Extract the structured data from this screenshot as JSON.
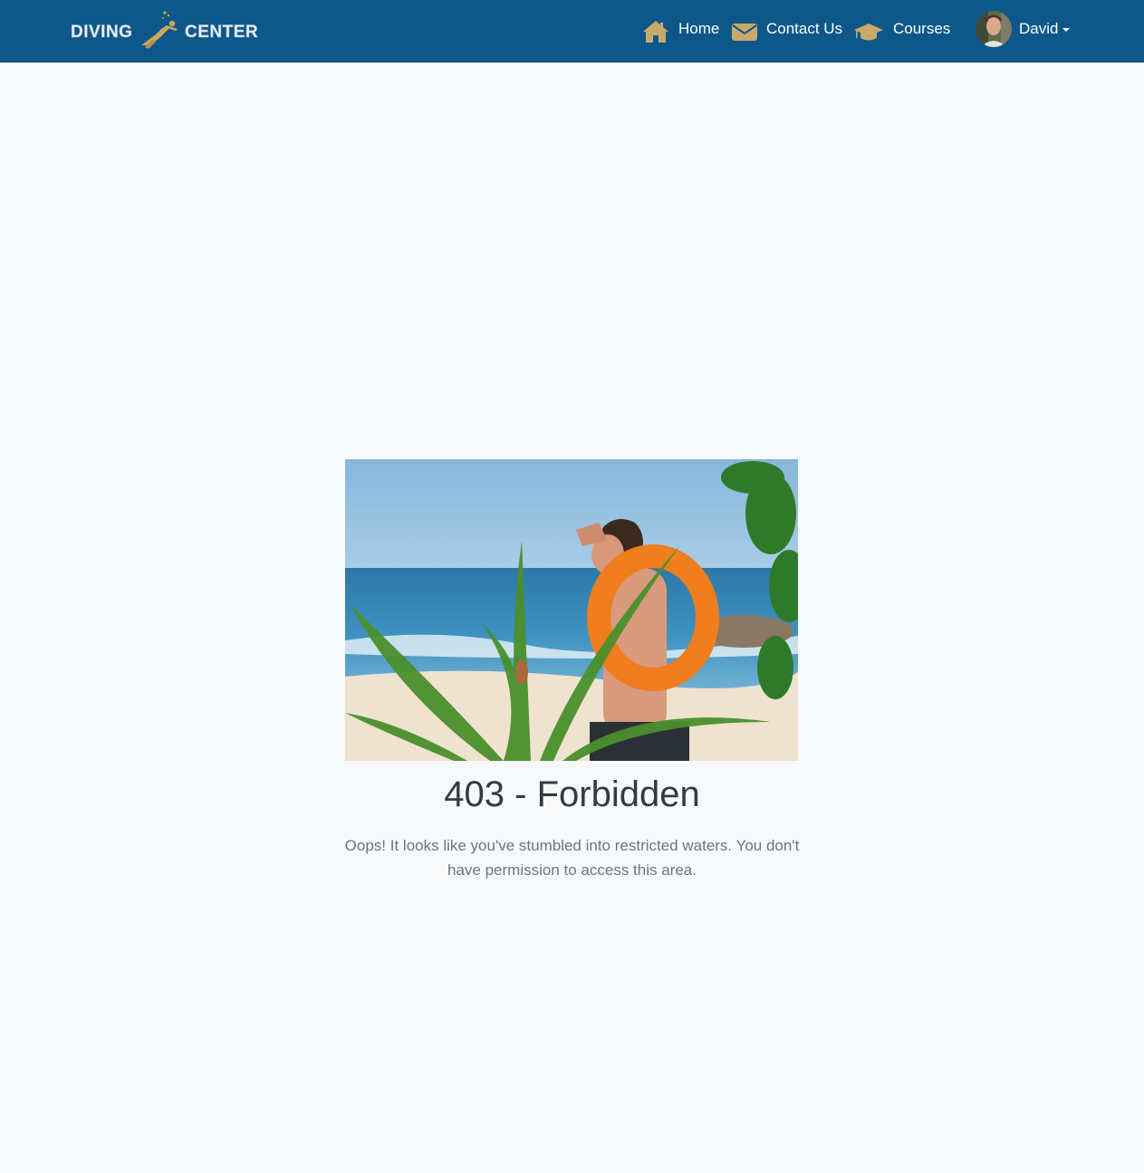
{
  "brand": {
    "logo_text_left": "DIVING",
    "logo_text_right": "CENTER",
    "logo_text_color": "#e9f0f8",
    "logo_accent_color": "#c9a957"
  },
  "nav": {
    "background_color": "#0e5889",
    "icon_color": "#c9a96a",
    "items": [
      {
        "label": "Home",
        "icon": "home-icon"
      },
      {
        "label": "Contact Us",
        "icon": "envelope-icon"
      },
      {
        "label": "Courses",
        "icon": "graduation-cap-icon"
      }
    ],
    "user": {
      "name": "David",
      "icon": "avatar"
    }
  },
  "error": {
    "title": "403 - Forbidden",
    "message": "Oops! It looks like you've stumbled into restricted waters. You don't have permission to access this area."
  }
}
